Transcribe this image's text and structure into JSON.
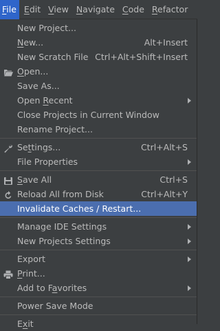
{
  "menubar": {
    "items": [
      {
        "text": "File",
        "mn": "F",
        "rest": "ile"
      },
      {
        "text": "Edit",
        "mn": "E",
        "rest": "dit"
      },
      {
        "text": "View",
        "mn": "V",
        "rest": "iew"
      },
      {
        "text": "Navigate",
        "mn": "N",
        "rest": "avigate"
      },
      {
        "text": "Code",
        "mn": "C",
        "rest": "ode"
      },
      {
        "text": "Refactor",
        "mn": "R",
        "rest": "efactor"
      }
    ]
  },
  "file_menu": {
    "new_project": {
      "pre": "New Project...",
      "mn": "",
      "post": ""
    },
    "new": {
      "pre": "",
      "mn": "N",
      "post": "ew...",
      "shortcut": "Alt+Insert"
    },
    "new_scratch": {
      "pre": "New Scratch File",
      "shortcut": "Ctrl+Alt+Shift+Insert"
    },
    "open": {
      "pre": "",
      "mn": "O",
      "post": "pen..."
    },
    "save_as": {
      "pre": "Save As..."
    },
    "open_recent": {
      "pre": "Open ",
      "mn": "R",
      "post": "ecent"
    },
    "close_projects": {
      "pre": "Close Projects in Current Window"
    },
    "rename_project": {
      "pre": "Rename Project..."
    },
    "settings": {
      "pre": "Se",
      "mn": "t",
      "post": "tings...",
      "shortcut": "Ctrl+Alt+S"
    },
    "file_properties": {
      "pre": "File Properties"
    },
    "save_all": {
      "pre": "",
      "mn": "S",
      "post": "ave All",
      "shortcut": "Ctrl+S"
    },
    "reload_all": {
      "pre": "Reload All from Disk",
      "shortcut": "Ctrl+Alt+Y"
    },
    "invalidate_caches": {
      "pre": "Invalidate Caches / Restart..."
    },
    "manage_ide_settings": {
      "pre": "Manage IDE Settings"
    },
    "new_projects_settings": {
      "pre": "New Projects Settings"
    },
    "export": {
      "pre": "Export"
    },
    "print": {
      "pre": "",
      "mn": "P",
      "post": "rint..."
    },
    "add_to_favorites": {
      "pre": "Add to F",
      "mn": "a",
      "post": "vorites"
    },
    "power_save": {
      "pre": "Power Save Mode"
    },
    "exit": {
      "pre": "E",
      "mn": "x",
      "post": "it"
    }
  },
  "colors": {
    "background": "#3c3f41",
    "text": "#bbbbbb",
    "menubar_active": "#2f65ca",
    "selected_row": "#4b6eaf",
    "separator": "#515151"
  },
  "icons": {
    "open": "folder-icon",
    "settings": "wrench-icon",
    "save_all": "floppy-disk-icon",
    "reload_all": "refresh-icon",
    "print": "printer-icon",
    "submenu": "chevron-right-icon"
  }
}
